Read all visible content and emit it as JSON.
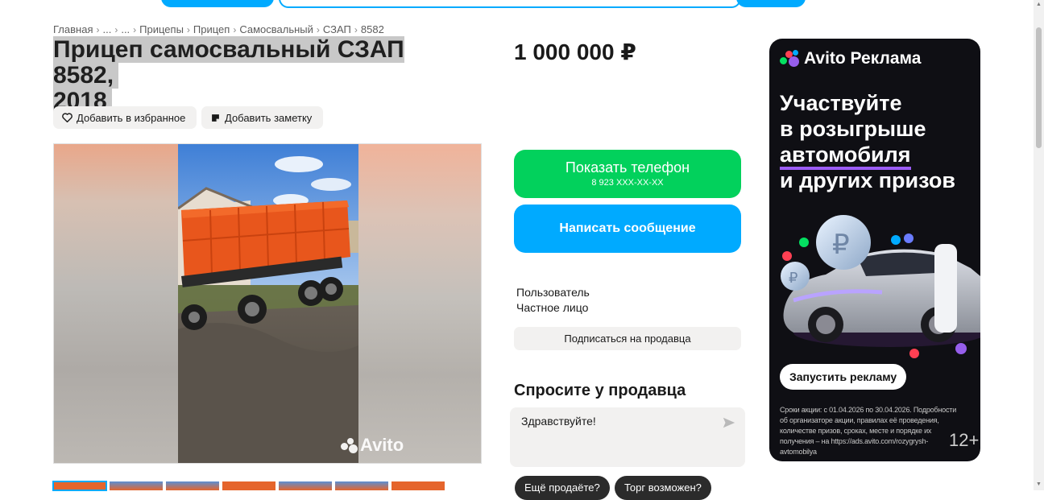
{
  "breadcrumb": {
    "items": [
      "Главная",
      "...",
      "...",
      "Прицепы",
      "Прицеп",
      "Самосвальный",
      "СЗАП",
      "8582"
    ]
  },
  "listing": {
    "title_line1": "Прицеп самосвальный СЗАП 8582,",
    "title_line2": "2018",
    "favorite_label": "Добавить в избранное",
    "note_label": "Добавить заметку",
    "watermark": "Avito",
    "thumbnail_count": 7
  },
  "sidebar": {
    "price": "1 000 000 ₽",
    "phone_button": "Показать телефон",
    "phone_masked": "8 923 XXX-XX-XX",
    "message_button": "Написать сообщение",
    "seller_name": "Пользователь",
    "seller_type": "Частное лицо",
    "subscribe_button": "Подписаться на продавца",
    "ask_title": "Спросите у продавца",
    "ask_text": "Здравствуйте!",
    "chips": [
      "Ещё продаёте?",
      "Торг возможен?"
    ]
  },
  "ad": {
    "brand": "Avito Реклама",
    "headline_1": "Участвуйте",
    "headline_2": "в розыгрыше",
    "headline_3": "автомобиля",
    "headline_4": "и других призов",
    "cta": "Запустить рекламу",
    "fine_print": "Сроки акции: с 01.04.2026 по 30.04.2026. Подробности об организаторе акции, правилах её проведения, количестве призов, сроках, месте и порядке их получения – на https://ads.avito.com/rozygrysh-avtomobilya",
    "age": "12+"
  },
  "colors": {
    "accent_blue": "#00aaff",
    "accent_green": "#02d15c",
    "chip_bg": "#f2f1f0",
    "ad_bg": "#0f0f14",
    "ad_underline": "#9b5cf6",
    "trailer_orange": "#e8561c"
  },
  "icons": {
    "favorite": "heart-outline-icon",
    "note": "note-icon",
    "send": "send-arrow-icon"
  }
}
